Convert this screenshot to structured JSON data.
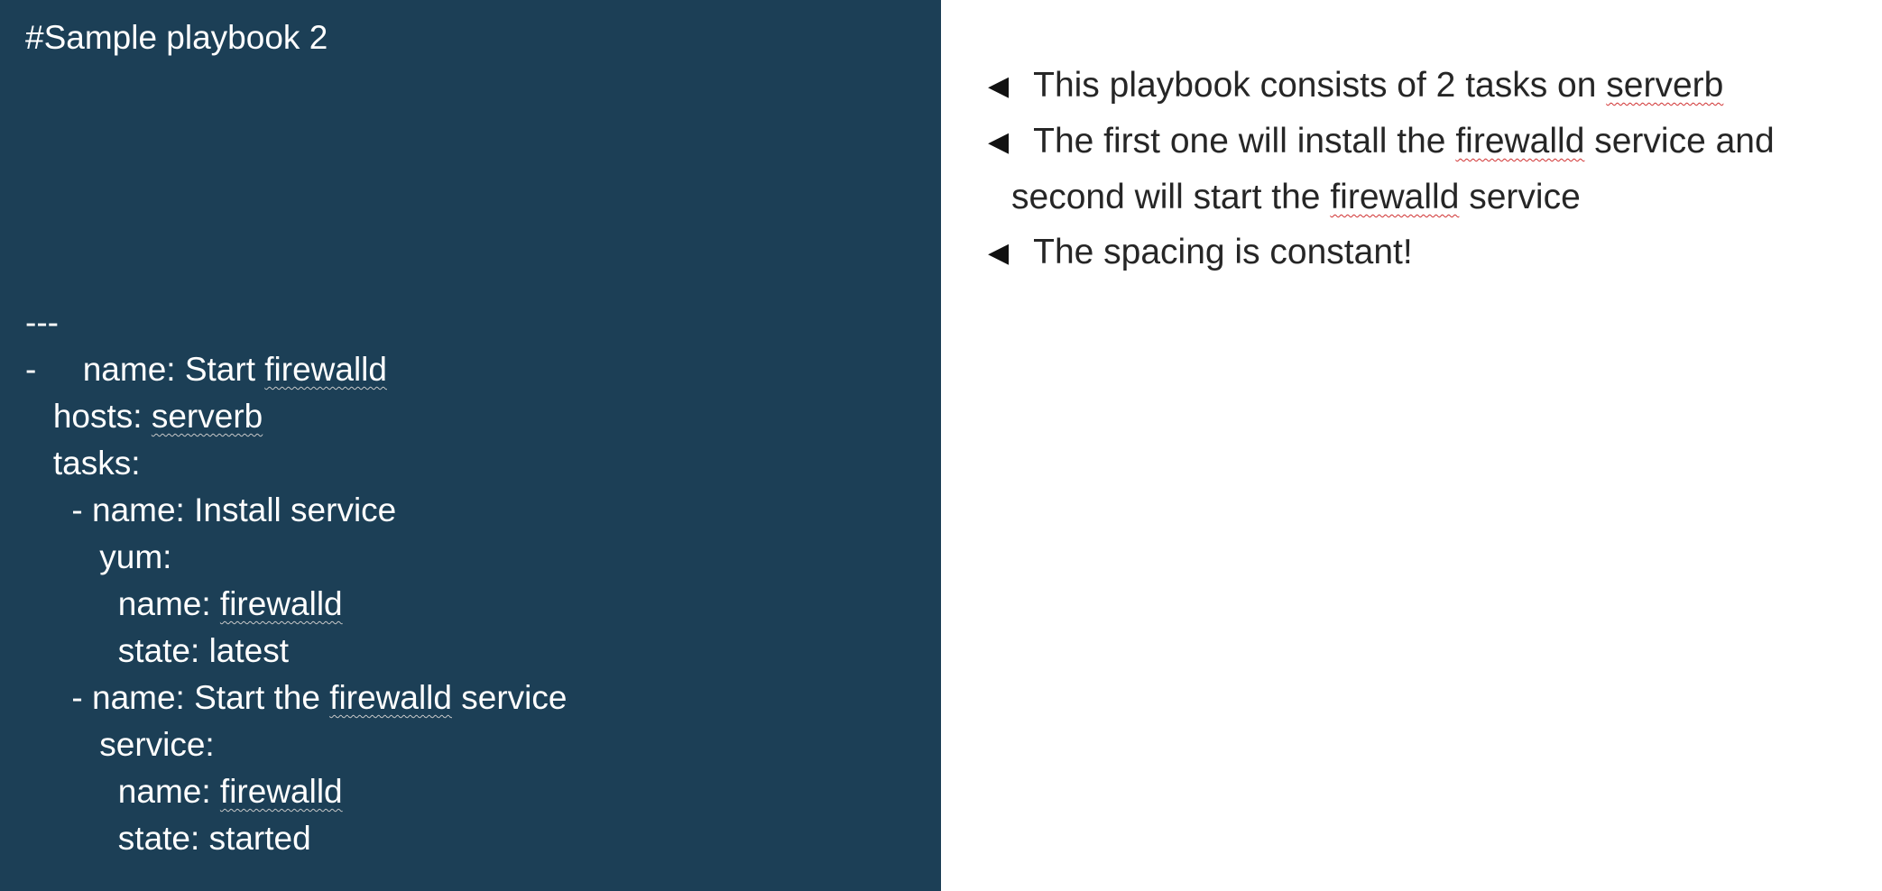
{
  "code_panel": {
    "title": "#Sample playbook 2",
    "lines": [
      [
        {
          "t": "---"
        }
      ],
      [
        {
          "t": "-     name: Start "
        },
        {
          "t": "firewalld",
          "sq": true
        }
      ],
      [
        {
          "t": "   hosts: "
        },
        {
          "t": "serverb",
          "sq": true
        }
      ],
      [
        {
          "t": "   tasks:"
        }
      ],
      [
        {
          "t": "     - name: Install service"
        }
      ],
      [
        {
          "t": "        yum:"
        }
      ],
      [
        {
          "t": "          name: "
        },
        {
          "t": "firewalld",
          "sq": true
        }
      ],
      [
        {
          "t": "          state: latest"
        }
      ],
      [
        {
          "t": "     - name: Start the "
        },
        {
          "t": "firewalld",
          "sq": true
        },
        {
          "t": " service"
        }
      ],
      [
        {
          "t": "        service:"
        }
      ],
      [
        {
          "t": "          name: "
        },
        {
          "t": "firewalld",
          "sq": true
        }
      ],
      [
        {
          "t": "          state: started"
        }
      ]
    ]
  },
  "notes": {
    "bullet_marker": "◀",
    "bullets": [
      {
        "marker": true,
        "parts": [
          {
            "t": " This playbook consists of 2 tasks on "
          },
          {
            "t": "serverb",
            "sq": true
          }
        ]
      },
      {
        "marker": true,
        "parts": [
          {
            "t": " The first one will install the "
          },
          {
            "t": "firewalld",
            "sq": true
          },
          {
            "t": " service and"
          }
        ]
      },
      {
        "marker": false,
        "parts": [
          {
            "t": "second will start the "
          },
          {
            "t": "firewalld",
            "sq": true
          },
          {
            "t": " service"
          }
        ]
      },
      {
        "marker": true,
        "parts": [
          {
            "t": " The spacing is constant!"
          }
        ]
      }
    ]
  }
}
